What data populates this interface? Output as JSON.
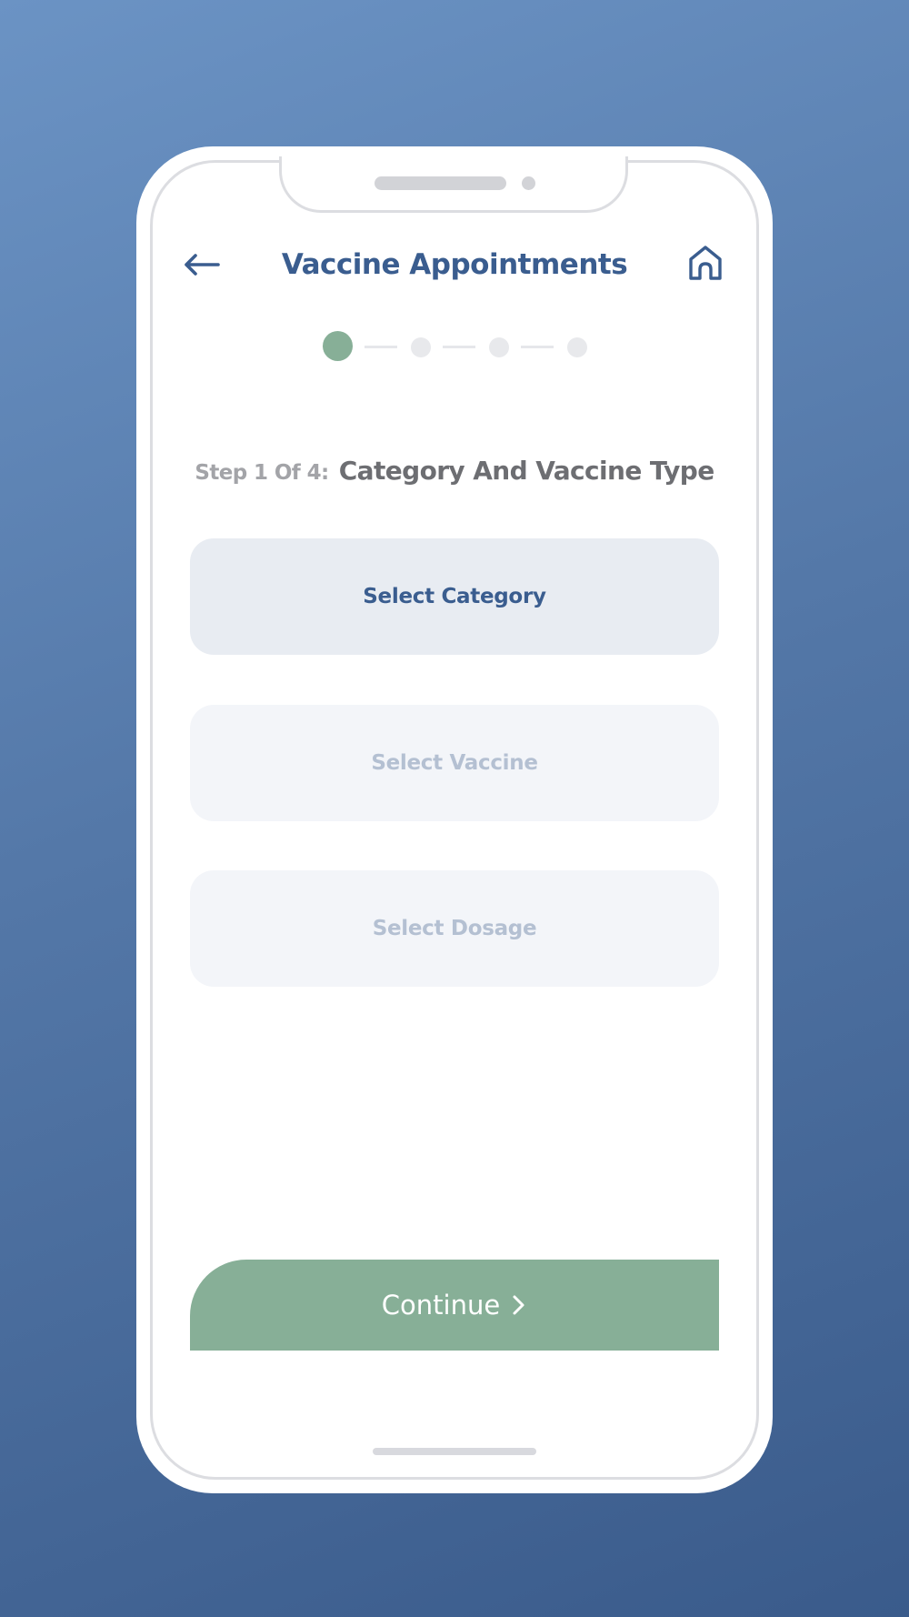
{
  "header": {
    "title": "Vaccine Appointments",
    "back_icon": "arrow-left-icon",
    "home_icon": "home-icon"
  },
  "stepper": {
    "total_steps": 4,
    "current_step": 1
  },
  "step": {
    "prefix": "Step 1 Of 4:",
    "name": "Category And Vaccine Type"
  },
  "fields": {
    "category": "Select Category",
    "vaccine": "Select Vaccine",
    "dosage": "Select Dosage"
  },
  "actions": {
    "continue_label": "Continue",
    "continue_icon": "chevron-right-icon"
  },
  "colors": {
    "brand_blue": "#3a5d8f",
    "accent_green": "#87af97",
    "disabled_text": "#b4c0d2"
  }
}
